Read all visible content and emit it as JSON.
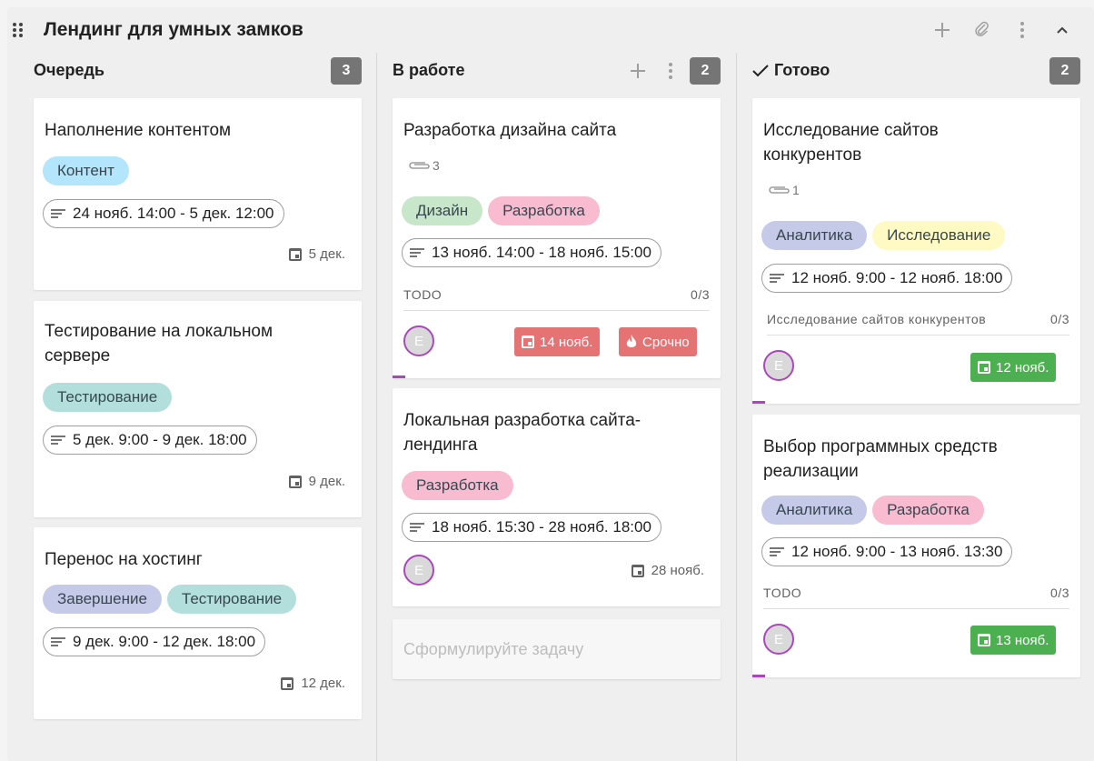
{
  "board": {
    "title": "Лендинг для умных замков",
    "icons": [
      "drag-handle-icon",
      "plus-icon",
      "link-icon",
      "more-vert-icon",
      "chevron-up-icon"
    ]
  },
  "columns": [
    {
      "title": "Очередь",
      "count": "3",
      "cards": [
        {
          "title": "Наполнение контентом",
          "tags": [
            "Контент"
          ],
          "period": "24 нояб. 14:00 - 5 дек. 12:00",
          "due": "5 дек."
        },
        {
          "title_lines": [
            "Тестирование на локальном",
            "сервере"
          ],
          "tags": [
            "Тестирование"
          ],
          "period": "5 дек. 9:00 - 9 дек. 18:00",
          "due": "9 дек."
        },
        {
          "title": "Перенос на хостинг",
          "tags": [
            "Завершение",
            "Тестирование"
          ],
          "period": "9 дек. 9:00 - 12 дек. 18:00",
          "due": "12 дек."
        }
      ]
    },
    {
      "title": "В работе",
      "count": "2",
      "cards": [
        {
          "title": "Разработка дизайна сайта",
          "attachments": "3",
          "tags": [
            "Дизайн",
            "Разработка"
          ],
          "period": "13 нояб. 14:00 - 18 нояб. 15:00",
          "checklist": {
            "name": "TODO",
            "progress": "0/3"
          },
          "avatar": "E",
          "due": "14 нояб.",
          "priority": "Срочно"
        },
        {
          "title_lines": [
            "Локальная разработка сайта-",
            "лендинга"
          ],
          "tags": [
            "Разработка"
          ],
          "period": "18 нояб. 15:30 - 28 нояб. 18:00",
          "avatar": "E",
          "due": "28 нояб."
        }
      ],
      "add_placeholder": "Сформулируйте задачу"
    },
    {
      "title": "Готово",
      "count": "2",
      "cards": [
        {
          "title_lines": [
            "Исследование сайтов",
            "конкурентов"
          ],
          "attachments": "1",
          "tags": [
            "Аналитика",
            "Исследование"
          ],
          "period": "12 нояб. 9:00 - 12 нояб. 18:00",
          "checklist": {
            "name": "Исследование сайтов конкурентов",
            "progress": "0/3"
          },
          "avatar": "E",
          "due": "12 нояб."
        },
        {
          "title_lines": [
            "Выбор программных средств",
            "реализации"
          ],
          "tags": [
            "Аналитика",
            "Разработка"
          ],
          "period": "12 нояб. 9:00 - 13 нояб. 13:30",
          "checklist": {
            "name": "TODO",
            "progress": "0/3"
          },
          "avatar": "E",
          "due": "13 нояб."
        }
      ]
    }
  ],
  "colors": {
    "overdue": "#e57373",
    "done": "#4caf50",
    "count_badge": "#757575",
    "assignee_ring": "#ab47bc"
  }
}
